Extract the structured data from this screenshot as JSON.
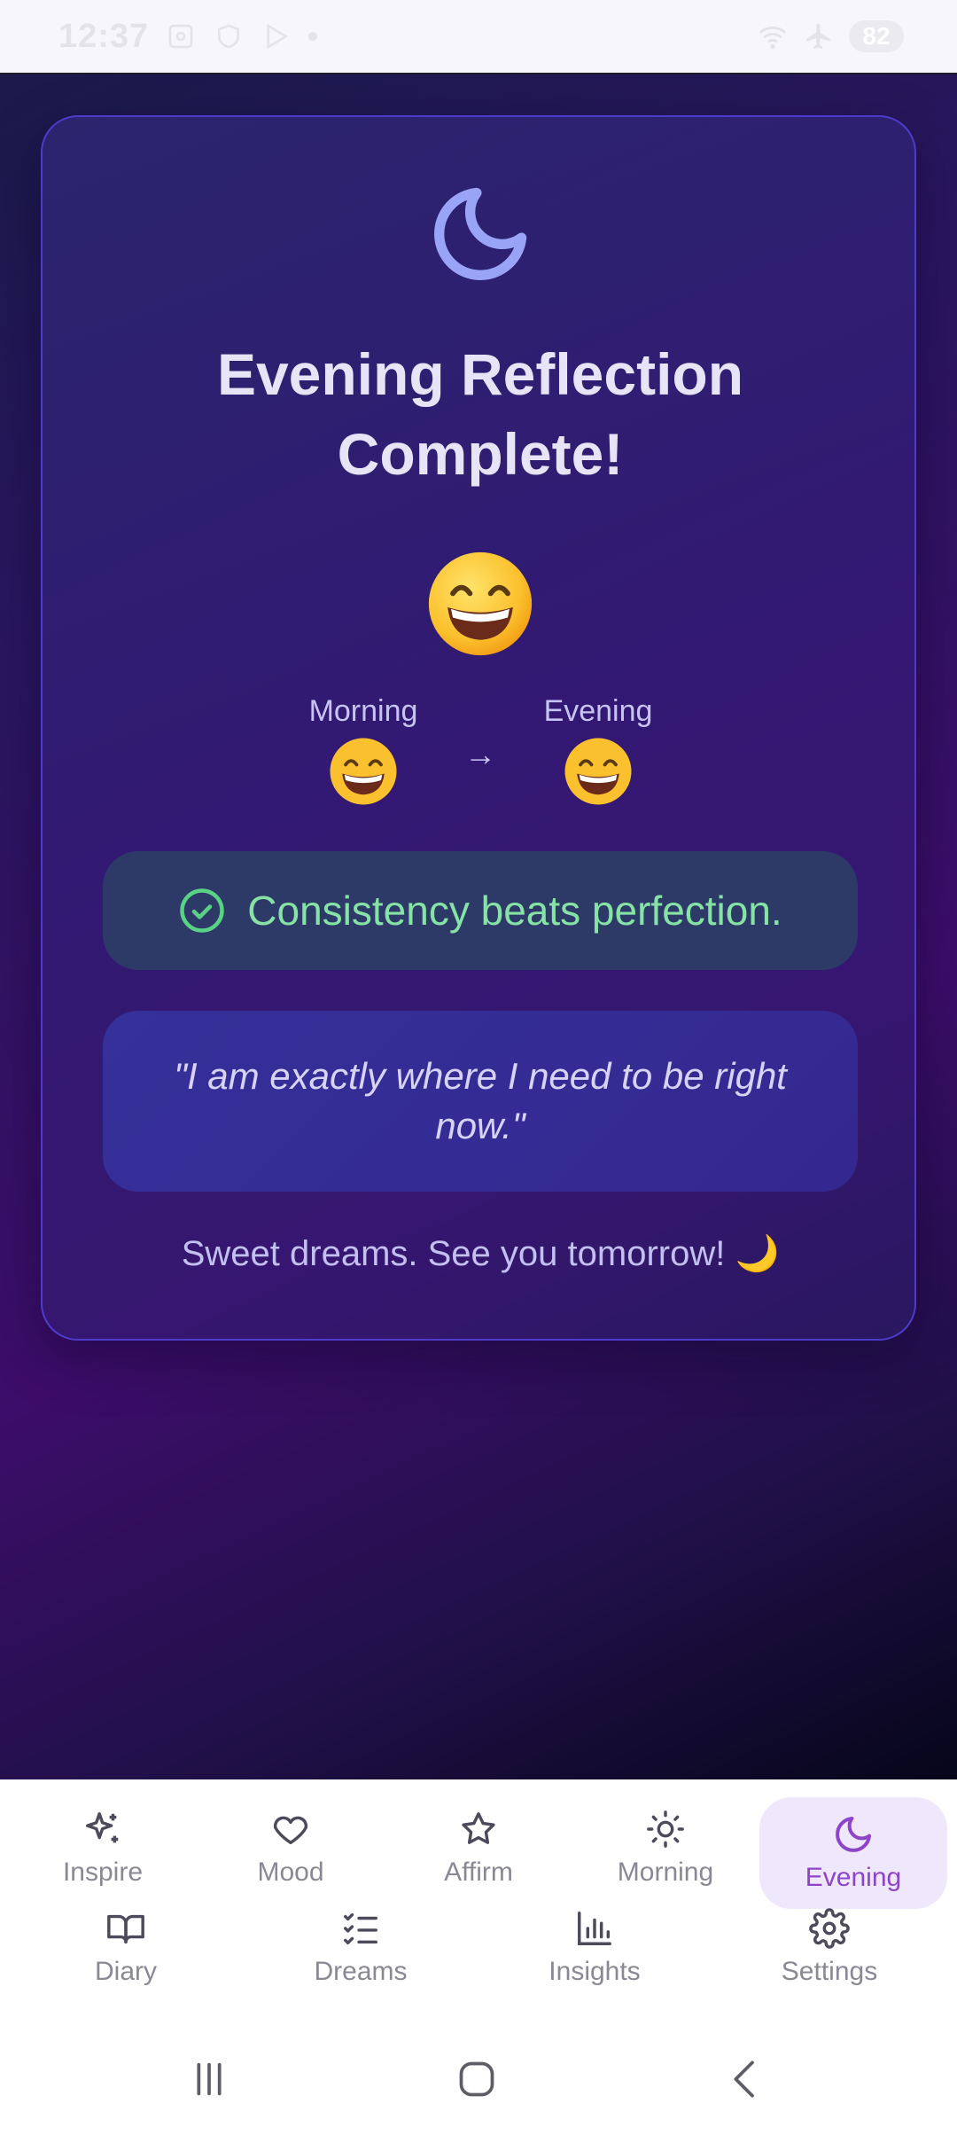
{
  "status_bar": {
    "time": "12:37",
    "battery": "82",
    "icons": [
      "screenshot-icon",
      "shield-icon",
      "play-store-icon",
      "dot-icon",
      "wifi-icon",
      "airplane-icon"
    ]
  },
  "card": {
    "title": "Evening Reflection Complete!",
    "main_emoji": "😄",
    "morning_label": "Morning",
    "morning_emoji": "😄",
    "arrow": "→",
    "evening_label": "Evening",
    "evening_emoji": "😄",
    "consistency_text": "Consistency beats perfection.",
    "affirmation": "\"I am exactly where I need to be right now.\"",
    "farewell": "Sweet dreams. See you tomorrow! 🌙"
  },
  "nav": {
    "row1": [
      {
        "label": "Inspire",
        "icon": "sparkles-icon"
      },
      {
        "label": "Mood",
        "icon": "heart-icon"
      },
      {
        "label": "Affirm",
        "icon": "star-icon"
      },
      {
        "label": "Morning",
        "icon": "sun-icon"
      },
      {
        "label": "Evening",
        "icon": "moon-icon",
        "active": true
      }
    ],
    "row2": [
      {
        "label": "Diary",
        "icon": "book-icon"
      },
      {
        "label": "Dreams",
        "icon": "checklist-icon"
      },
      {
        "label": "Insights",
        "icon": "bar-chart-icon"
      },
      {
        "label": "Settings",
        "icon": "gear-icon"
      }
    ]
  },
  "colors": {
    "accent": "#8e44c9",
    "success_text": "#86e3a5",
    "card_border": "#4d3bcb"
  }
}
